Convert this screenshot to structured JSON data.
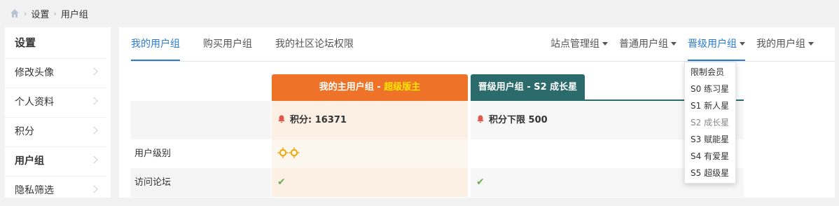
{
  "breadcrumb": {
    "home_icon": "home-icon",
    "items": [
      "设置",
      "用户组"
    ]
  },
  "sidebar": {
    "title": "设置",
    "items": [
      {
        "label": "修改头像",
        "active": false
      },
      {
        "label": "个人资料",
        "active": false
      },
      {
        "label": "积分",
        "active": false
      },
      {
        "label": "用户组",
        "active": true
      },
      {
        "label": "隐私筛选",
        "active": false
      }
    ]
  },
  "tabs": [
    {
      "label": "我的用户组",
      "active": true
    },
    {
      "label": "购买用户组",
      "active": false
    },
    {
      "label": "我的社区论坛权限",
      "active": false
    }
  ],
  "group_menus": [
    {
      "label": "站点管理组",
      "active": false
    },
    {
      "label": "普通用户组",
      "active": false
    },
    {
      "label": "晋级用户组",
      "active": true
    },
    {
      "label": "我的用户组",
      "active": false
    }
  ],
  "dropdown": {
    "items": [
      "限制会员",
      "S0 练习星",
      "S1 新人星",
      "S2 成长星",
      "S3 赋能星",
      "S4 有爱星",
      "S5 超级星"
    ],
    "current": "S2 成长星"
  },
  "table": {
    "row_labels": [
      "用户级别",
      "访问论坛"
    ],
    "mine": {
      "header_prefix": "我的主用户组 - ",
      "header_group": "超级版主",
      "score_text": "积分: 16371"
    },
    "next": {
      "header": "晋级用户组 - S2 成长星",
      "score_text": "积分下限 500"
    },
    "check_glyph": "✔"
  },
  "colors": {
    "accent": "#2b7bd0",
    "mine_header": "#ee7228",
    "next_header": "#2c6b6b",
    "vip_text": "#ffe500",
    "check": "#6ab04c",
    "bell": "#e0574a"
  }
}
